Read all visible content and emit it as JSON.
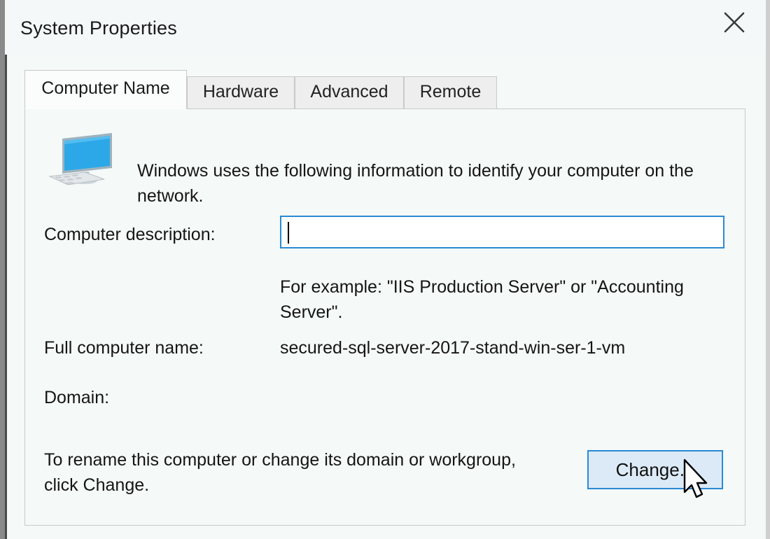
{
  "window": {
    "title": "System Properties",
    "close_label": "✕",
    "close_icon": "close-icon"
  },
  "tabs": [
    {
      "label": "Computer Name",
      "active": true
    },
    {
      "label": "Hardware",
      "active": false
    },
    {
      "label": "Advanced",
      "active": false
    },
    {
      "label": "Remote",
      "active": false
    }
  ],
  "panel": {
    "icon": "computer-monitor-icon",
    "header_description": "Windows uses the following information to identify your computer on the network.",
    "computer_description": {
      "label": "Computer description:",
      "value": "",
      "placeholder": ""
    },
    "example_text": "For example: \"IIS Production Server\" or \"Accounting Server\".",
    "full_computer_name": {
      "label": "Full computer name:",
      "value": "secured-sql-server-2017-stand-win-ser-1-vm"
    },
    "domain": {
      "label": "Domain:",
      "value": ""
    },
    "rename_text": "To rename this computer or change its domain or workgroup, click Change.",
    "change_button": "Change..."
  },
  "colors": {
    "window_background": "#f5f9f8",
    "titlebar": "#f4f8f8",
    "accent_blue": "#2a8ad4",
    "button_fill": "#dceaf7",
    "tab_inactive": "#eeeeee",
    "tab_active": "#fbfdfd",
    "border": "#c9c9c9",
    "text": "#151515",
    "icon_monitor": "#2ca8e8"
  }
}
